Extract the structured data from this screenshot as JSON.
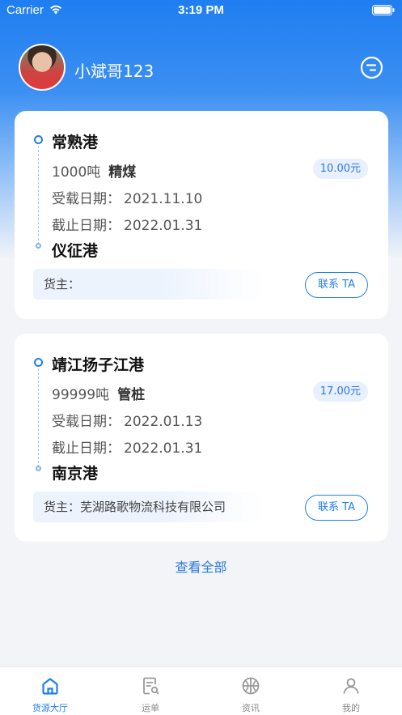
{
  "status_bar": {
    "carrier": "Carrier",
    "time": "3:19 PM"
  },
  "header": {
    "username": "小斌哥123",
    "message_icon": "message-icon"
  },
  "colors": {
    "primary": "#1f7ef0",
    "badge_bg": "#e7f0fc"
  },
  "cards": [
    {
      "origin": "常熟港",
      "quantity": "1000吨",
      "cargo": "精煤",
      "price": "10.00元",
      "load_date_label": "受载日期：",
      "load_date": "2021.11.10",
      "end_date_label": "截止日期：",
      "end_date": "2022.01.31",
      "destination": "仪征港",
      "owner_label": "货主：",
      "owner_name": "",
      "contact_label": "联系 TA"
    },
    {
      "origin": "靖江扬子江港",
      "quantity": "99999吨",
      "cargo": "管桩",
      "price": "17.00元",
      "load_date_label": "受载日期：",
      "load_date": "2022.01.13",
      "end_date_label": "截止日期：",
      "end_date": "2022.01.31",
      "destination": "南京港",
      "owner_label": "货主：",
      "owner_name": "芜湖路歌物流科技有限公司",
      "contact_label": "联系 TA"
    }
  ],
  "view_all": "查看全部",
  "tabs": [
    {
      "label": "货源大厅",
      "icon": "home-icon",
      "active": true
    },
    {
      "label": "运单",
      "icon": "waybill-icon",
      "active": false
    },
    {
      "label": "资讯",
      "icon": "news-icon",
      "active": false
    },
    {
      "label": "我的",
      "icon": "profile-icon",
      "active": false
    }
  ]
}
